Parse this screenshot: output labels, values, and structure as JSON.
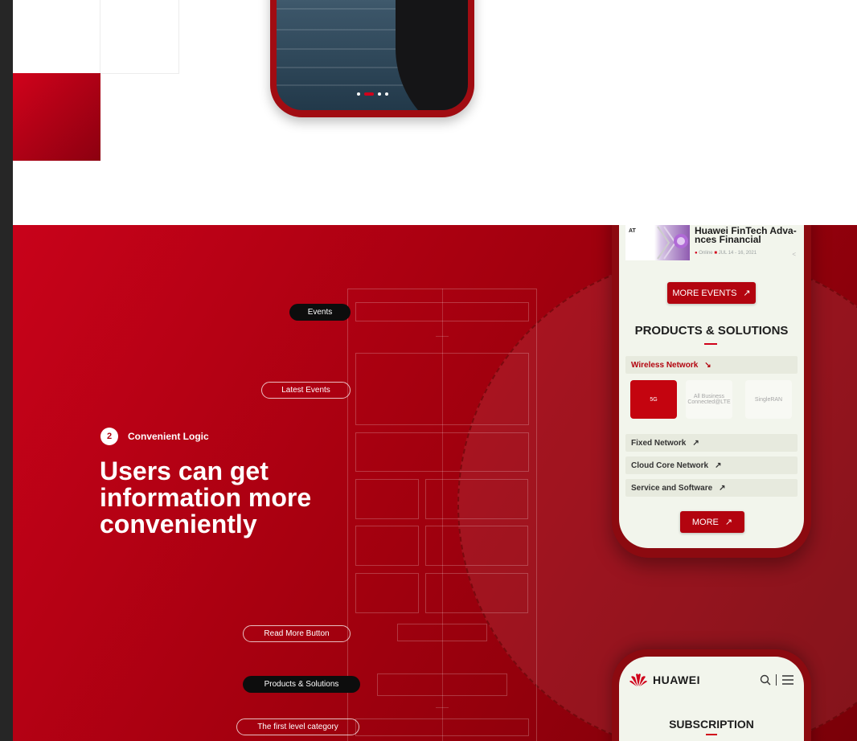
{
  "hero_phone": {
    "carousel_dots": 4,
    "active_dot_index": 1
  },
  "feature": {
    "step_number": "2",
    "step_label": "Convenient Logic",
    "headline": "Users can get information more conveniently"
  },
  "wireframe_labels": {
    "events": "Events",
    "latest_events": "Latest Events",
    "read_more_button": "Read More Button",
    "products_solutions": "Products & Solutions",
    "first_level_category": "The first level category"
  },
  "mobile_preview": {
    "event": {
      "logo_text": "AT",
      "title": "Huawei FinTech Adva-nces Financial",
      "location": "Online",
      "date": "JUL 14 - 16, 2021"
    },
    "more_events_button": "MORE EVENTS",
    "products_title": "PRODUCTS & SOLUTIONS",
    "categories": [
      {
        "label": "Wireless Network",
        "icon": "arrow-down-right-icon",
        "active": true
      },
      {
        "label": "Fixed Network",
        "icon": "arrow-up-right-icon",
        "active": false
      },
      {
        "label": "Cloud Core Network",
        "icon": "arrow-up-right-icon",
        "active": false
      },
      {
        "label": "Service and Software",
        "icon": "arrow-up-right-icon",
        "active": false
      }
    ],
    "subcategories": [
      {
        "label": "5G",
        "active": true
      },
      {
        "label": "All Business Connected@LTE",
        "active": false
      },
      {
        "label": "SingleRAN",
        "active": false
      }
    ],
    "more_button": "MORE"
  },
  "mobile_header": {
    "brand": "HUAWEI",
    "subscription_title": "SUBSCRIPTION"
  },
  "colors": {
    "brand_red": "#d0021b",
    "dark_red": "#7a0008",
    "phone_screen_bg": "#f2f5ec"
  }
}
